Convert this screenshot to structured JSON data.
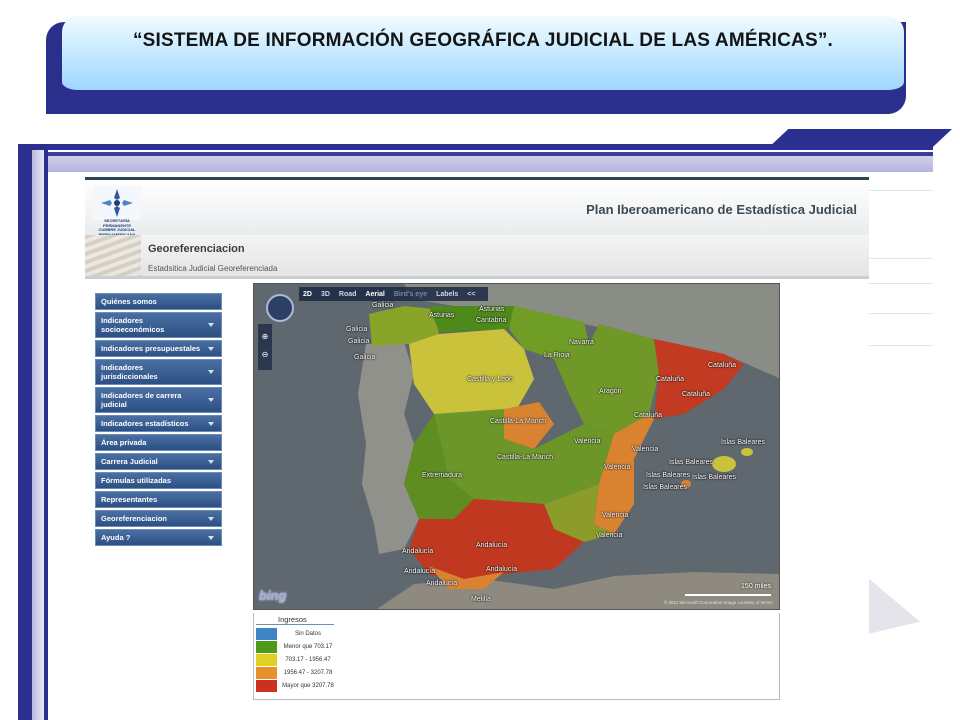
{
  "slide": {
    "title": "“SISTEMA DE INFORMACIÓN GEOGRÁFICA JUDICIAL DE LAS AMÉRICAS”."
  },
  "site": {
    "logo_text": [
      "SECRETARÍA PERMANENTE",
      "CUMBRE JUDICIAL",
      "IBEROAMERICANA"
    ],
    "header_title": "Plan Iberoamericano de Estadística Judicial",
    "section_title": "Georeferenciacion",
    "section_subtitle": "Estadsitica Judicial Georeferenciada"
  },
  "menu": {
    "items": [
      {
        "label": "Quiénes somos",
        "has_arrow": false
      },
      {
        "label": "Indicadores socioeconómicos",
        "has_arrow": true
      },
      {
        "label": "Indicadores presupuestales",
        "has_arrow": true
      },
      {
        "label": "Indicadores jurisdiccionales",
        "has_arrow": true
      },
      {
        "label": "Indicadores de carrera judicial",
        "has_arrow": true
      },
      {
        "label": "Indicadores estadísticos",
        "has_arrow": true
      },
      {
        "label": "Área privada",
        "has_arrow": false
      },
      {
        "label": "Carrera Judicial",
        "has_arrow": true
      },
      {
        "label": "Fórmulas utilizadas",
        "has_arrow": false
      },
      {
        "label": "Representantes",
        "has_arrow": false
      },
      {
        "label": "Georeferenciacion",
        "has_arrow": true
      },
      {
        "label": "Ayuda ?",
        "has_arrow": true
      }
    ]
  },
  "map": {
    "toolbar": {
      "mode_2d": "2D",
      "mode_3d": "3D",
      "road": "Road",
      "aerial": "Aerial",
      "birds_eye": "Bird's eye",
      "labels": "Labels",
      "collapse": "<<"
    },
    "zoom_in": "⊕",
    "zoom_out": "⊖",
    "scale_label": "150 miles",
    "brand": "bing",
    "copyright": "© 2011 Microsoft Corporation   Image courtesy of NASA",
    "labels": {
      "galicia": "Galicia",
      "asturias": "Asturias",
      "cantabria": "Cantabria",
      "navarra": "Navarra",
      "la_rioja": "La Rioja",
      "castilla_leon": "Castilla y León",
      "aragon": "Aragón",
      "cataluna": "Cataluña",
      "castilla_mancha": "Castilla-La Manch",
      "valencia": "Valencia",
      "extremadura": "Extremadura",
      "islas_baleares": "Islas Baleares",
      "andalucia": "Andalucía",
      "melilla": "Melilla"
    }
  },
  "legend": {
    "title": "Ingresos",
    "items": [
      {
        "label": "Sin Datos",
        "color": "#3f84c4"
      },
      {
        "label": "Menor que 703.17",
        "color": "#4e9a1a"
      },
      {
        "label": "703.17 - 1956.47",
        "color": "#e0d022"
      },
      {
        "label": "1956.47 - 3207.78",
        "color": "#e8902a"
      },
      {
        "label": "Mayor que 3207.78",
        "color": "#c8321e"
      }
    ]
  },
  "colors": {
    "frame": "#2b2f90",
    "menu": "#2d5084",
    "green": "#7a9e2a",
    "yellow": "#c8c43a",
    "orange": "#d98230",
    "red": "#c33a22"
  }
}
